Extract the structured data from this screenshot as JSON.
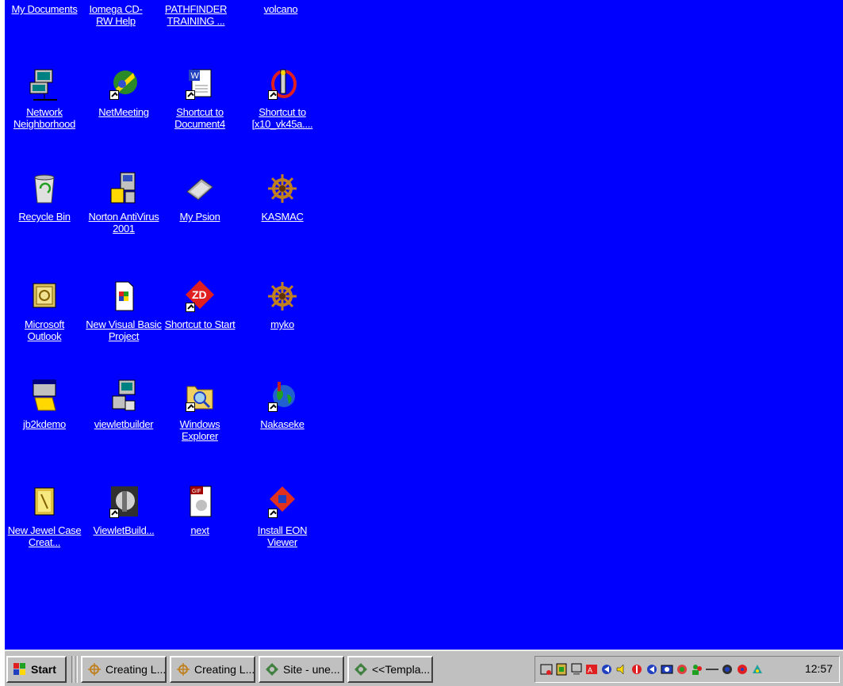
{
  "desktop": {
    "background": "#0000ff",
    "icons": [
      {
        "label": "My Documents"
      },
      {
        "label": "Iomega CD-RW Help"
      },
      {
        "label": "PATHFINDER TRAINING ..."
      },
      {
        "label": "volcano"
      },
      {
        "label": "Network Neighborhood",
        "icon": "network-neighborhood-icon"
      },
      {
        "label": "NetMeeting",
        "icon": "netmeeting-icon"
      },
      {
        "label": "Shortcut to Document4",
        "icon": "word-document-icon"
      },
      {
        "label": "Shortcut to [x10_vk45a....",
        "icon": "shortcut-icon"
      },
      {
        "label": "Recycle Bin",
        "icon": "recycle-bin-icon"
      },
      {
        "label": "Norton AntiVirus 2001",
        "icon": "norton-antivirus-icon"
      },
      {
        "label": "My Psion",
        "icon": "psion-icon"
      },
      {
        "label": "KASMAC",
        "icon": "ship-wheel-icon"
      },
      {
        "label": "Microsoft Outlook",
        "icon": "outlook-icon"
      },
      {
        "label": "New Visual Basic Project",
        "icon": "vb-project-icon"
      },
      {
        "label": "Shortcut to Start",
        "icon": "zd-icon"
      },
      {
        "label": "myko",
        "icon": "ship-wheel-icon"
      },
      {
        "label": "jb2kdemo",
        "icon": "setup-icon"
      },
      {
        "label": "viewletbuilder",
        "icon": "viewletbuilder-icon"
      },
      {
        "label": "Windows Explorer",
        "icon": "explorer-icon"
      },
      {
        "label": "Nakaseke",
        "icon": "globe-icon"
      },
      {
        "label": "New Jewel Case Creat...",
        "icon": "jewel-case-icon"
      },
      {
        "label": "ViewletBuild...",
        "icon": "viewlet-shortcut-icon"
      },
      {
        "label": "next",
        "icon": "gif-file-icon"
      },
      {
        "label": "Install EON Viewer",
        "icon": "eon-icon"
      }
    ]
  },
  "taskbar": {
    "start_label": "Start",
    "tasks": [
      {
        "label": "Creating L..."
      },
      {
        "label": "Creating L..."
      },
      {
        "label": "Site - une..."
      },
      {
        "label": "<<Templa..."
      }
    ],
    "clock": "12:57"
  }
}
